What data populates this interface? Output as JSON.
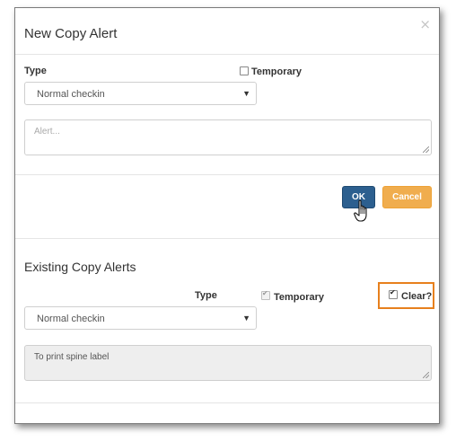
{
  "dialog": {
    "title": "New Copy Alert",
    "close_glyph": "×"
  },
  "new_alert": {
    "type_label": "Type",
    "temporary_label": "Temporary",
    "temporary_checked": false,
    "type_value": "Normal checkin",
    "alert_placeholder": "Alert...",
    "ok_label": "OK",
    "cancel_label": "Cancel"
  },
  "existing": {
    "section_title": "Existing Copy Alerts",
    "type_label": "Type",
    "temporary_label": "Temporary",
    "temporary_checked": true,
    "clear_label": "Clear?",
    "clear_checked": true,
    "type_value": "Normal checkin",
    "alert_text": "To print spine label"
  },
  "colors": {
    "ok_button": "#2c5f8f",
    "cancel_button": "#f0ad4e",
    "highlight": "#e7801d"
  },
  "icons": [
    "close-icon",
    "dropdown-arrow-icon",
    "hand-pointer-cursor-icon",
    "resize-grip-icon"
  ]
}
